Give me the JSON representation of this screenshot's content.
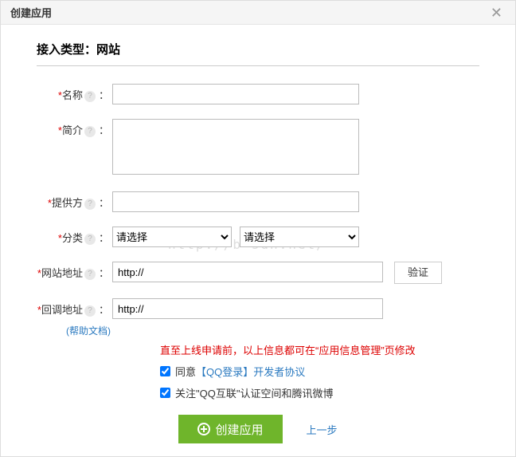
{
  "dialog": {
    "title": "创建应用",
    "close": "✕"
  },
  "section_header": "接入类型：网站",
  "labels": {
    "name": "名称",
    "intro": "简介",
    "provider": "提供方",
    "category": "分类",
    "site_url": "网站地址",
    "callback_url": "回调地址",
    "colon": "："
  },
  "fields": {
    "name": "",
    "intro": "",
    "provider": "",
    "category1": "请选择",
    "category2": "请选择",
    "site_url": "http://",
    "callback_url": "http://"
  },
  "buttons": {
    "verify": "验证",
    "create": "创建应用",
    "prev": "上一步"
  },
  "links": {
    "help_doc": "(帮助文档)"
  },
  "notes": {
    "red": "直至上线申请前，以上信息都可在“应用信息管理”页修改"
  },
  "checkboxes": {
    "agree_pre": "同意",
    "agree_link": "【QQ登录】开发者协议",
    "follow": "关注\"QQ互联\"认证空间和腾讯微博"
  },
  "checked": {
    "agree": true,
    "follow": true
  },
  "watermark": "http://b    sdn.net/"
}
